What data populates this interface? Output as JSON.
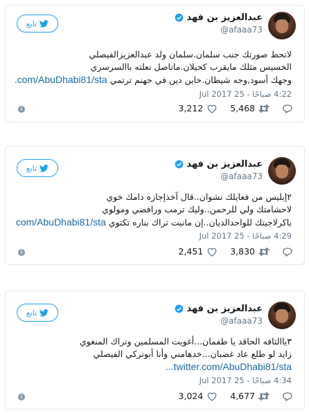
{
  "tweets": [
    {
      "follow_label": "تابع",
      "name": "عبدالعزيز بن فهد",
      "handle": "@afaaa73",
      "lines": [
        "لاتحط صورتك جنب سلمان.سلمان ولد عبدالعزيزالفيصلي",
        "الخسيس مثلك مايقرب كحيلان.ماتاصل نعلته باالسرسري",
        "وجهك أسود,وجه شيطان.خاين دين في جهنم ترتمي"
      ],
      "link": "twitter.com/AbuDhabi81/sta...",
      "time": "4:22 صباحًا - 25 Jul 2017",
      "likes": "3,212",
      "retweets": "5,468"
    },
    {
      "follow_label": "تابع",
      "name": "عبدالعزيز بن فهد",
      "handle": "@afaaa73",
      "lines": [
        "٢إبليس من فعايلك نشوان..قال آخذإجازه دامك خوي",
        "لاحشامتك ولي للرحمن..وليك ترمب ورافضي ومولوي",
        "باكرلاجيتك للواحدالديان..إن مانبت تراك بناره تكتوي"
      ],
      "link": "twitter.com/AbuDhabi81/sta...",
      "time": "4:29 صباحًا - 25 Jul 2017",
      "likes": "2,451",
      "retweets": "3,830"
    },
    {
      "follow_label": "تابع",
      "name": "عبدالعزيز بن فهد",
      "handle": "@afaaa73",
      "lines": [
        "٣ياالتافه الحاقد يا طفمان...أغويت المسلمين وتراك المنغوي",
        "زايد لو طلع عاد غضبان...خدهامني وأنا أبوتركي الفيصلي"
      ],
      "link": "twitter.com/AbuDhabi81/sta...",
      "time": "4:34 صباحًا - 25 Jul 2017",
      "likes": "3,024",
      "retweets": "4,677"
    }
  ],
  "colors": {
    "accent": "#1da1f2",
    "link": "#1b6aa5",
    "muted": "#657786"
  },
  "icons": [
    "twitter-bird-icon",
    "verified-badge-icon",
    "heart-icon",
    "retweet-icon",
    "reply-icon",
    "info-icon"
  ]
}
